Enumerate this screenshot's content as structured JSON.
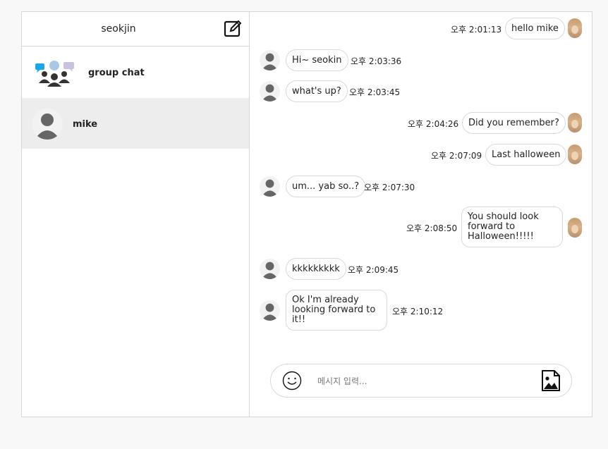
{
  "sidebar": {
    "username": "seokjin",
    "rooms": [
      {
        "name": "group chat",
        "icon": "group-chat-icon"
      },
      {
        "name": "mike",
        "icon": "user-avatar",
        "active": true
      }
    ]
  },
  "messages": [
    {
      "side": "me",
      "text": "hello mike",
      "time": "오후 2:01:13"
    },
    {
      "side": "other",
      "text": "Hi~ seokin",
      "time": "오후 2:03:36"
    },
    {
      "side": "other",
      "text": "what's up?",
      "time": "오후 2:03:45"
    },
    {
      "side": "me",
      "text": "Did you remember?",
      "time": "오후 2:04:26"
    },
    {
      "side": "me",
      "text": "Last halloween",
      "time": "오후 2:07:09"
    },
    {
      "side": "other",
      "text": "um... yab so..?",
      "time": "오후 2:07:30"
    },
    {
      "side": "me",
      "text": "You should look forward to Halloween!!!!!",
      "time": "오후 2:08:50"
    },
    {
      "side": "other",
      "text": "kkkkkkkkk",
      "time": "오후 2:09:45"
    },
    {
      "side": "other",
      "text": "Ok I'm already looking forward to it!!",
      "time": "오후 2:10:12"
    }
  ],
  "composer": {
    "placeholder": "메시지 입력...",
    "emoji_icon": "smiley-icon",
    "image_icon": "image-upload-icon"
  }
}
